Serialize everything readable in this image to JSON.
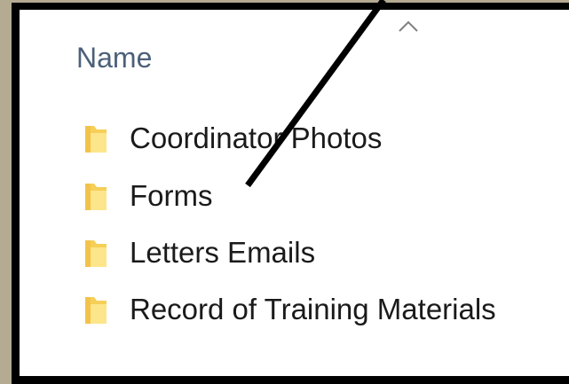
{
  "window": {
    "frame_color": "#000000",
    "background_color": "#b5ab93",
    "panel_color": "#ffffff"
  },
  "header": {
    "name_column_label": "Name",
    "sort_icon": "chevron-up-icon"
  },
  "files": [
    {
      "label": "Coordinator Photos",
      "icon": "folder-icon"
    },
    {
      "label": "Forms",
      "icon": "folder-icon"
    },
    {
      "label": "Letters Emails",
      "icon": "folder-icon"
    },
    {
      "label": "Record of Training Materials",
      "icon": "folder-icon"
    }
  ],
  "colors": {
    "header_text": "#4c607a",
    "folder_body": "#f6cf57",
    "folder_front": "#fde58b",
    "annotation_line": "#000000"
  }
}
